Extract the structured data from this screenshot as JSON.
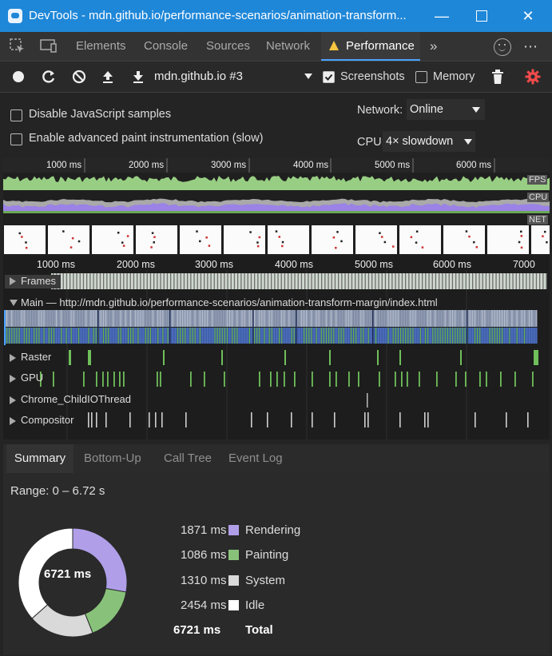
{
  "window": {
    "title": "DevTools - mdn.github.io/performance-scenarios/animation-transform..."
  },
  "tabs": [
    {
      "label": "Elements"
    },
    {
      "label": "Console"
    },
    {
      "label": "Sources"
    },
    {
      "label": "Network"
    },
    {
      "label": "Performance"
    }
  ],
  "toolbar": {
    "profile_select": "mdn.github.io #3",
    "screenshots_label": "Screenshots",
    "screenshots_checked": true,
    "memory_label": "Memory",
    "memory_checked": false
  },
  "settings": {
    "disable_js_label": "Disable JavaScript samples",
    "paint_instr_label": "Enable advanced paint instrumentation (slow)",
    "network_label": "Network:",
    "network_value": "Online",
    "cpu_label": "CPU:",
    "cpu_value": "4× slowdown"
  },
  "overview": {
    "ticks": [
      "1000 ms",
      "2000 ms",
      "3000 ms",
      "4000 ms",
      "5000 ms",
      "6000 ms"
    ],
    "fps_label": "FPS",
    "cpu_label": "CPU",
    "net_label": "NET"
  },
  "timeline": {
    "ticks": [
      "1000 ms",
      "2000 ms",
      "3000 ms",
      "4000 ms",
      "5000 ms",
      "6000 ms",
      "7000"
    ],
    "frames_label": "Frames",
    "main_label": "Main — http://mdn.github.io/performance-scenarios/animation-transform-margin/index.html",
    "tracks": [
      "Raster",
      "GPU",
      "Chrome_ChildIOThread",
      "Compositor"
    ]
  },
  "bottom_tabs": [
    "Summary",
    "Bottom-Up",
    "Call Tree",
    "Event Log"
  ],
  "summary": {
    "range": "Range: 0 – 6.72 s",
    "center_total": "6721 ms",
    "rows": [
      {
        "value": "1871 ms",
        "label": "Rendering",
        "color": "#b09fe8"
      },
      {
        "value": "1086 ms",
        "label": "Painting",
        "color": "#88c27a"
      },
      {
        "value": "1310 ms",
        "label": "System",
        "color": "#d9d9d9"
      },
      {
        "value": "2454 ms",
        "label": "Idle",
        "color": "#ffffff"
      }
    ],
    "total_value": "6721 ms",
    "total_label": "Total"
  }
}
